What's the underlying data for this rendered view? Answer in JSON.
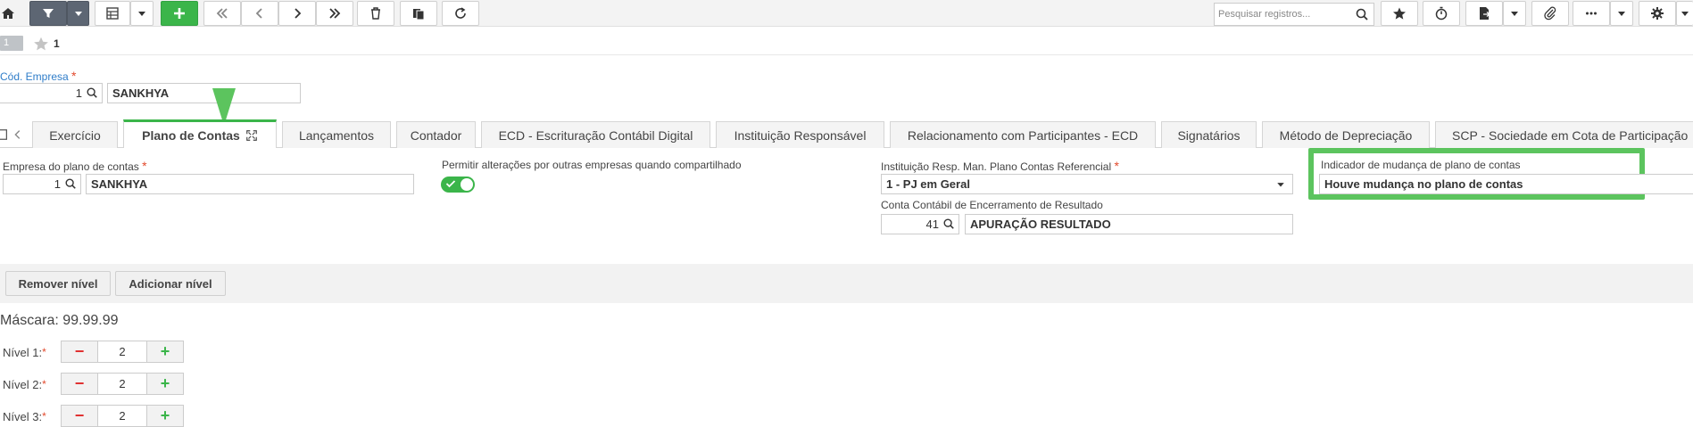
{
  "toolbar": {
    "search_placeholder": "Pesquisar registros...",
    "icons": [
      "home-icon",
      "filter-icon",
      "grid-view-icon",
      "add-icon",
      "first-record-icon",
      "previous-record-icon",
      "next-record-icon",
      "last-record-icon",
      "delete-icon",
      "duplicate-icon",
      "refresh-icon",
      "search-icon",
      "favorite-icon",
      "timer-icon",
      "export-icon",
      "attachment-icon",
      "more-icon",
      "settings-icon"
    ],
    "accent": "#3bb54a"
  },
  "record": {
    "number": "1",
    "favorites_count": "1"
  },
  "header": {
    "company_code_label": "Cód. Empresa",
    "company_code": "1",
    "company_name": "SANKHYA"
  },
  "tabs": [
    {
      "label": "Exercício"
    },
    {
      "label": "Plano de Contas"
    },
    {
      "label": "Lançamentos"
    },
    {
      "label": "Contador"
    },
    {
      "label": "ECD - Escrituração Contábil Digital"
    },
    {
      "label": "Instituição Responsável"
    },
    {
      "label": "Relacionamento com Participantes - ECD"
    },
    {
      "label": "Signatários"
    },
    {
      "label": "Método de Depreciação"
    },
    {
      "label": "SCP - Sociedade em Cota de Participação"
    }
  ],
  "form": {
    "plan_company_label": "Empresa do plano de contas",
    "plan_company_code": "1",
    "plan_company_name": "SANKHYA",
    "allow_changes_label": "Permitir alterações por outras empresas quando compartilhado",
    "allow_changes_on": true,
    "institution_label": "Instituição Resp. Man. Plano Contas Referencial",
    "institution_value": "1 - PJ em Geral",
    "closing_account_label": "Conta Contábil de Encerramento de Resultado",
    "closing_account_code": "41",
    "closing_account_name": "APURAÇÃO RESULTADO",
    "change_indicator_label": "Indicador de mudança de plano de contas",
    "change_indicator_value": "Houve mudança no plano de contas"
  },
  "levels": {
    "remove_label": "Remover nível",
    "add_label": "Adicionar nível",
    "mask_text": "Máscara: 99.99.99",
    "items": [
      {
        "label": "Nível 1:",
        "value": "2"
      },
      {
        "label": "Nível 2:",
        "value": "2"
      },
      {
        "label": "Nível 3:",
        "value": "2"
      }
    ]
  }
}
